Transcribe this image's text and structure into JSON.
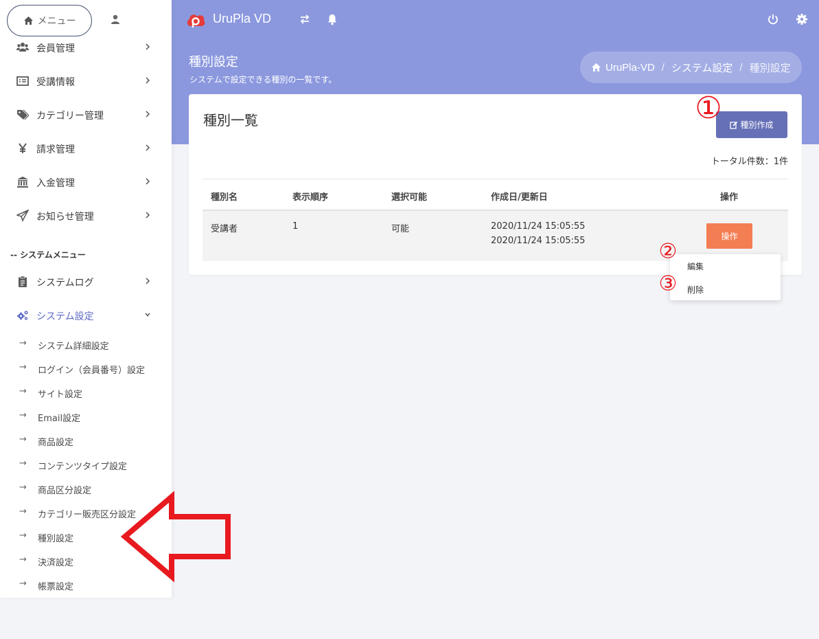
{
  "app": {
    "title": "UruPla VD"
  },
  "sidebar": {
    "menu_label": "メニュー",
    "items": [
      {
        "label": "会員管理",
        "icon": "users-icon"
      },
      {
        "label": "受講情報",
        "icon": "list-card-icon"
      },
      {
        "label": "カテゴリー管理",
        "icon": "tags-icon"
      },
      {
        "label": "請求管理",
        "icon": "yen-icon"
      },
      {
        "label": "入金管理",
        "icon": "bank-icon"
      },
      {
        "label": "お知らせ管理",
        "icon": "paper-plane-icon"
      }
    ],
    "section_label": "-- システムメニュー",
    "system_items": [
      {
        "label": "システムログ",
        "icon": "clipboard-icon"
      },
      {
        "label": "システム設定",
        "icon": "cogs-icon"
      }
    ],
    "sub_items": [
      "システム詳細設定",
      "ログイン（会員番号）設定",
      "サイト設定",
      "Email設定",
      "商品設定",
      "コンテンツタイプ設定",
      "商品区分設定",
      "カテゴリー販売区分設定",
      "種別設定",
      "決済設定",
      "帳票設定"
    ],
    "sub_arrow": "→"
  },
  "page": {
    "title": "種別設定",
    "subtitle": "システムで設定できる種別の一覧です。"
  },
  "breadcrumb": {
    "home": "UruPla-VD",
    "parent": "システム設定",
    "current": "種別設定",
    "separator": "/"
  },
  "card": {
    "title": "種別一覧",
    "create_label": "種別作成",
    "total": "トータル件数：1件",
    "columns": [
      "種別名",
      "表示順序",
      "選択可能",
      "作成日/更新日",
      "操作"
    ],
    "rows": [
      {
        "name": "受講者",
        "order": "1",
        "selectable": "可能",
        "created": "2020/11/24 15:05:55",
        "updated": "2020/11/24 15:05:55",
        "action": "操作"
      }
    ]
  },
  "dropdown": {
    "edit": "編集",
    "delete": "削除"
  },
  "annotations": {
    "one": "①",
    "two": "②",
    "three": "③"
  },
  "colors": {
    "header": "#8b98de",
    "accent": "#5d6ac4",
    "create_button": "#6670b7",
    "action_button": "#f47e53",
    "annotation": "#e8191f"
  }
}
